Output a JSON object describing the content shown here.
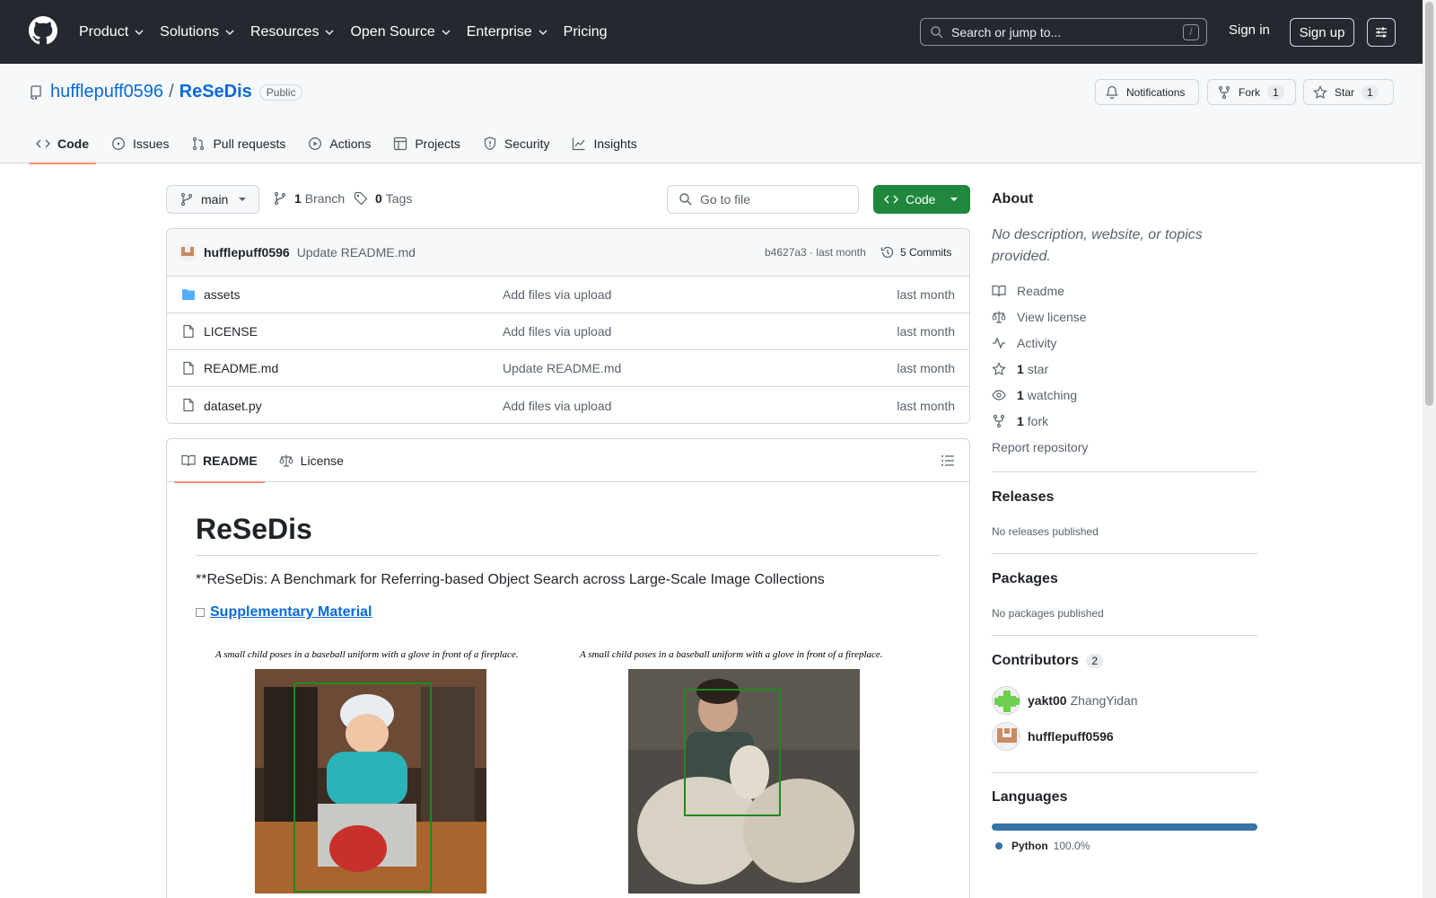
{
  "header": {
    "nav": [
      "Product",
      "Solutions",
      "Resources",
      "Open Source",
      "Enterprise",
      "Pricing"
    ],
    "search_placeholder": "Search or jump to...",
    "search_shortcut": "/",
    "sign_in": "Sign in",
    "sign_up": "Sign up"
  },
  "repo": {
    "owner": "hufflepuff0596",
    "separator": "/",
    "name": "ReSeDis",
    "visibility": "Public",
    "notifications_label": "Notifications",
    "fork_label": "Fork",
    "fork_count": "1",
    "star_label": "Star",
    "star_count": "1"
  },
  "tabs": [
    "Code",
    "Issues",
    "Pull requests",
    "Actions",
    "Projects",
    "Security",
    "Insights"
  ],
  "toolbar": {
    "branch": "main",
    "branch_count": "1",
    "branch_label": "Branch",
    "tag_count": "0",
    "tag_label": "Tags",
    "goto_file": "Go to file",
    "code_button": "Code"
  },
  "commit": {
    "author": "hufflepuff0596",
    "message": "Update README.md",
    "hash_time": "b4627a3 · last month",
    "commits": "5 Commits"
  },
  "files": [
    {
      "type": "folder",
      "name": "assets",
      "message": "Add files via upload",
      "date": "last month"
    },
    {
      "type": "file",
      "name": "LICENSE",
      "message": "Add files via upload",
      "date": "last month"
    },
    {
      "type": "file",
      "name": "README.md",
      "message": "Update README.md",
      "date": "last month"
    },
    {
      "type": "file",
      "name": "dataset.py",
      "message": "Add files via upload",
      "date": "last month"
    }
  ],
  "readme": {
    "tab_readme": "README",
    "tab_license": "License",
    "title": "ReSeDis",
    "subtitle": "**ReSeDis: A Benchmark for Referring-based Object Search across Large-Scale Image Collections",
    "link": "Supplementary Material",
    "caption_left": "A small child poses in a baseball uniform with a glove in front of a fireplace.",
    "caption_right": "A small child poses in a baseball uniform with a glove in front of a fireplace."
  },
  "about": {
    "title": "About",
    "description": "No description, website, or topics provided.",
    "readme": "Readme",
    "license": "View license",
    "activity": "Activity",
    "stars_count": "1",
    "stars_label": "star",
    "watching_count": "1",
    "watching_label": "watching",
    "forks_count": "1",
    "forks_label": "fork",
    "report": "Report repository"
  },
  "releases": {
    "title": "Releases",
    "text": "No releases published"
  },
  "packages": {
    "title": "Packages",
    "text": "No packages published"
  },
  "contributors": {
    "title": "Contributors",
    "count": "2",
    "list": [
      {
        "login": "yakt00",
        "name": "ZhangYidan"
      },
      {
        "login": "hufflepuff0596",
        "name": ""
      }
    ]
  },
  "languages": {
    "title": "Languages",
    "name": "Python",
    "percent": "100.0%",
    "color": "#3572A5"
  }
}
